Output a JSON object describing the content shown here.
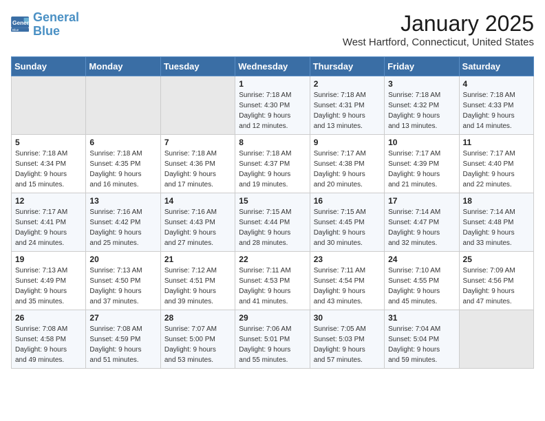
{
  "header": {
    "logo_line1": "General",
    "logo_line2": "Blue",
    "month_title": "January 2025",
    "location": "West Hartford, Connecticut, United States"
  },
  "weekdays": [
    "Sunday",
    "Monday",
    "Tuesday",
    "Wednesday",
    "Thursday",
    "Friday",
    "Saturday"
  ],
  "weeks": [
    [
      {
        "day": "",
        "info": ""
      },
      {
        "day": "",
        "info": ""
      },
      {
        "day": "",
        "info": ""
      },
      {
        "day": "1",
        "info": "Sunrise: 7:18 AM\nSunset: 4:30 PM\nDaylight: 9 hours\nand 12 minutes."
      },
      {
        "day": "2",
        "info": "Sunrise: 7:18 AM\nSunset: 4:31 PM\nDaylight: 9 hours\nand 13 minutes."
      },
      {
        "day": "3",
        "info": "Sunrise: 7:18 AM\nSunset: 4:32 PM\nDaylight: 9 hours\nand 13 minutes."
      },
      {
        "day": "4",
        "info": "Sunrise: 7:18 AM\nSunset: 4:33 PM\nDaylight: 9 hours\nand 14 minutes."
      }
    ],
    [
      {
        "day": "5",
        "info": "Sunrise: 7:18 AM\nSunset: 4:34 PM\nDaylight: 9 hours\nand 15 minutes."
      },
      {
        "day": "6",
        "info": "Sunrise: 7:18 AM\nSunset: 4:35 PM\nDaylight: 9 hours\nand 16 minutes."
      },
      {
        "day": "7",
        "info": "Sunrise: 7:18 AM\nSunset: 4:36 PM\nDaylight: 9 hours\nand 17 minutes."
      },
      {
        "day": "8",
        "info": "Sunrise: 7:18 AM\nSunset: 4:37 PM\nDaylight: 9 hours\nand 19 minutes."
      },
      {
        "day": "9",
        "info": "Sunrise: 7:17 AM\nSunset: 4:38 PM\nDaylight: 9 hours\nand 20 minutes."
      },
      {
        "day": "10",
        "info": "Sunrise: 7:17 AM\nSunset: 4:39 PM\nDaylight: 9 hours\nand 21 minutes."
      },
      {
        "day": "11",
        "info": "Sunrise: 7:17 AM\nSunset: 4:40 PM\nDaylight: 9 hours\nand 22 minutes."
      }
    ],
    [
      {
        "day": "12",
        "info": "Sunrise: 7:17 AM\nSunset: 4:41 PM\nDaylight: 9 hours\nand 24 minutes."
      },
      {
        "day": "13",
        "info": "Sunrise: 7:16 AM\nSunset: 4:42 PM\nDaylight: 9 hours\nand 25 minutes."
      },
      {
        "day": "14",
        "info": "Sunrise: 7:16 AM\nSunset: 4:43 PM\nDaylight: 9 hours\nand 27 minutes."
      },
      {
        "day": "15",
        "info": "Sunrise: 7:15 AM\nSunset: 4:44 PM\nDaylight: 9 hours\nand 28 minutes."
      },
      {
        "day": "16",
        "info": "Sunrise: 7:15 AM\nSunset: 4:45 PM\nDaylight: 9 hours\nand 30 minutes."
      },
      {
        "day": "17",
        "info": "Sunrise: 7:14 AM\nSunset: 4:47 PM\nDaylight: 9 hours\nand 32 minutes."
      },
      {
        "day": "18",
        "info": "Sunrise: 7:14 AM\nSunset: 4:48 PM\nDaylight: 9 hours\nand 33 minutes."
      }
    ],
    [
      {
        "day": "19",
        "info": "Sunrise: 7:13 AM\nSunset: 4:49 PM\nDaylight: 9 hours\nand 35 minutes."
      },
      {
        "day": "20",
        "info": "Sunrise: 7:13 AM\nSunset: 4:50 PM\nDaylight: 9 hours\nand 37 minutes."
      },
      {
        "day": "21",
        "info": "Sunrise: 7:12 AM\nSunset: 4:51 PM\nDaylight: 9 hours\nand 39 minutes."
      },
      {
        "day": "22",
        "info": "Sunrise: 7:11 AM\nSunset: 4:53 PM\nDaylight: 9 hours\nand 41 minutes."
      },
      {
        "day": "23",
        "info": "Sunrise: 7:11 AM\nSunset: 4:54 PM\nDaylight: 9 hours\nand 43 minutes."
      },
      {
        "day": "24",
        "info": "Sunrise: 7:10 AM\nSunset: 4:55 PM\nDaylight: 9 hours\nand 45 minutes."
      },
      {
        "day": "25",
        "info": "Sunrise: 7:09 AM\nSunset: 4:56 PM\nDaylight: 9 hours\nand 47 minutes."
      }
    ],
    [
      {
        "day": "26",
        "info": "Sunrise: 7:08 AM\nSunset: 4:58 PM\nDaylight: 9 hours\nand 49 minutes."
      },
      {
        "day": "27",
        "info": "Sunrise: 7:08 AM\nSunset: 4:59 PM\nDaylight: 9 hours\nand 51 minutes."
      },
      {
        "day": "28",
        "info": "Sunrise: 7:07 AM\nSunset: 5:00 PM\nDaylight: 9 hours\nand 53 minutes."
      },
      {
        "day": "29",
        "info": "Sunrise: 7:06 AM\nSunset: 5:01 PM\nDaylight: 9 hours\nand 55 minutes."
      },
      {
        "day": "30",
        "info": "Sunrise: 7:05 AM\nSunset: 5:03 PM\nDaylight: 9 hours\nand 57 minutes."
      },
      {
        "day": "31",
        "info": "Sunrise: 7:04 AM\nSunset: 5:04 PM\nDaylight: 9 hours\nand 59 minutes."
      },
      {
        "day": "",
        "info": ""
      }
    ]
  ]
}
